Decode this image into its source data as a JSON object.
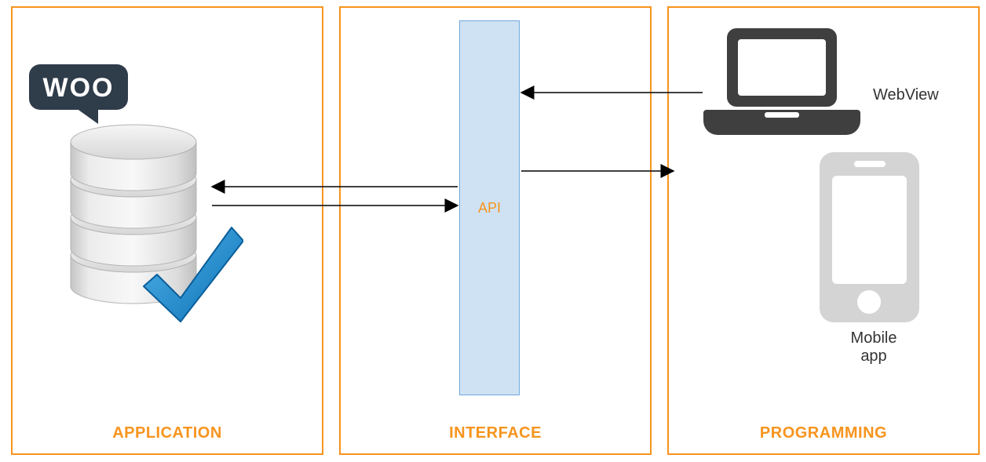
{
  "panels": {
    "application": {
      "title": "APPLICATION"
    },
    "interface": {
      "title": "INTERFACE"
    },
    "programming": {
      "title": "PROGRAMMING"
    }
  },
  "api_label": "API",
  "woo_label": "WOO",
  "webview_label": "WebView",
  "mobile_app_label": "Mobile\napp",
  "colors": {
    "accent": "#F7941E",
    "api_fill": "#CFE2F3",
    "api_border": "#6FA8DC",
    "laptop": "#3f3f3f",
    "phone": "#d4d4d4",
    "db_light": "#ebebeb",
    "db_mid": "#d7d7d7",
    "db_dark": "#bcbcbc",
    "check": "#1f8fd6",
    "woo_bg": "#2f3c4a"
  }
}
